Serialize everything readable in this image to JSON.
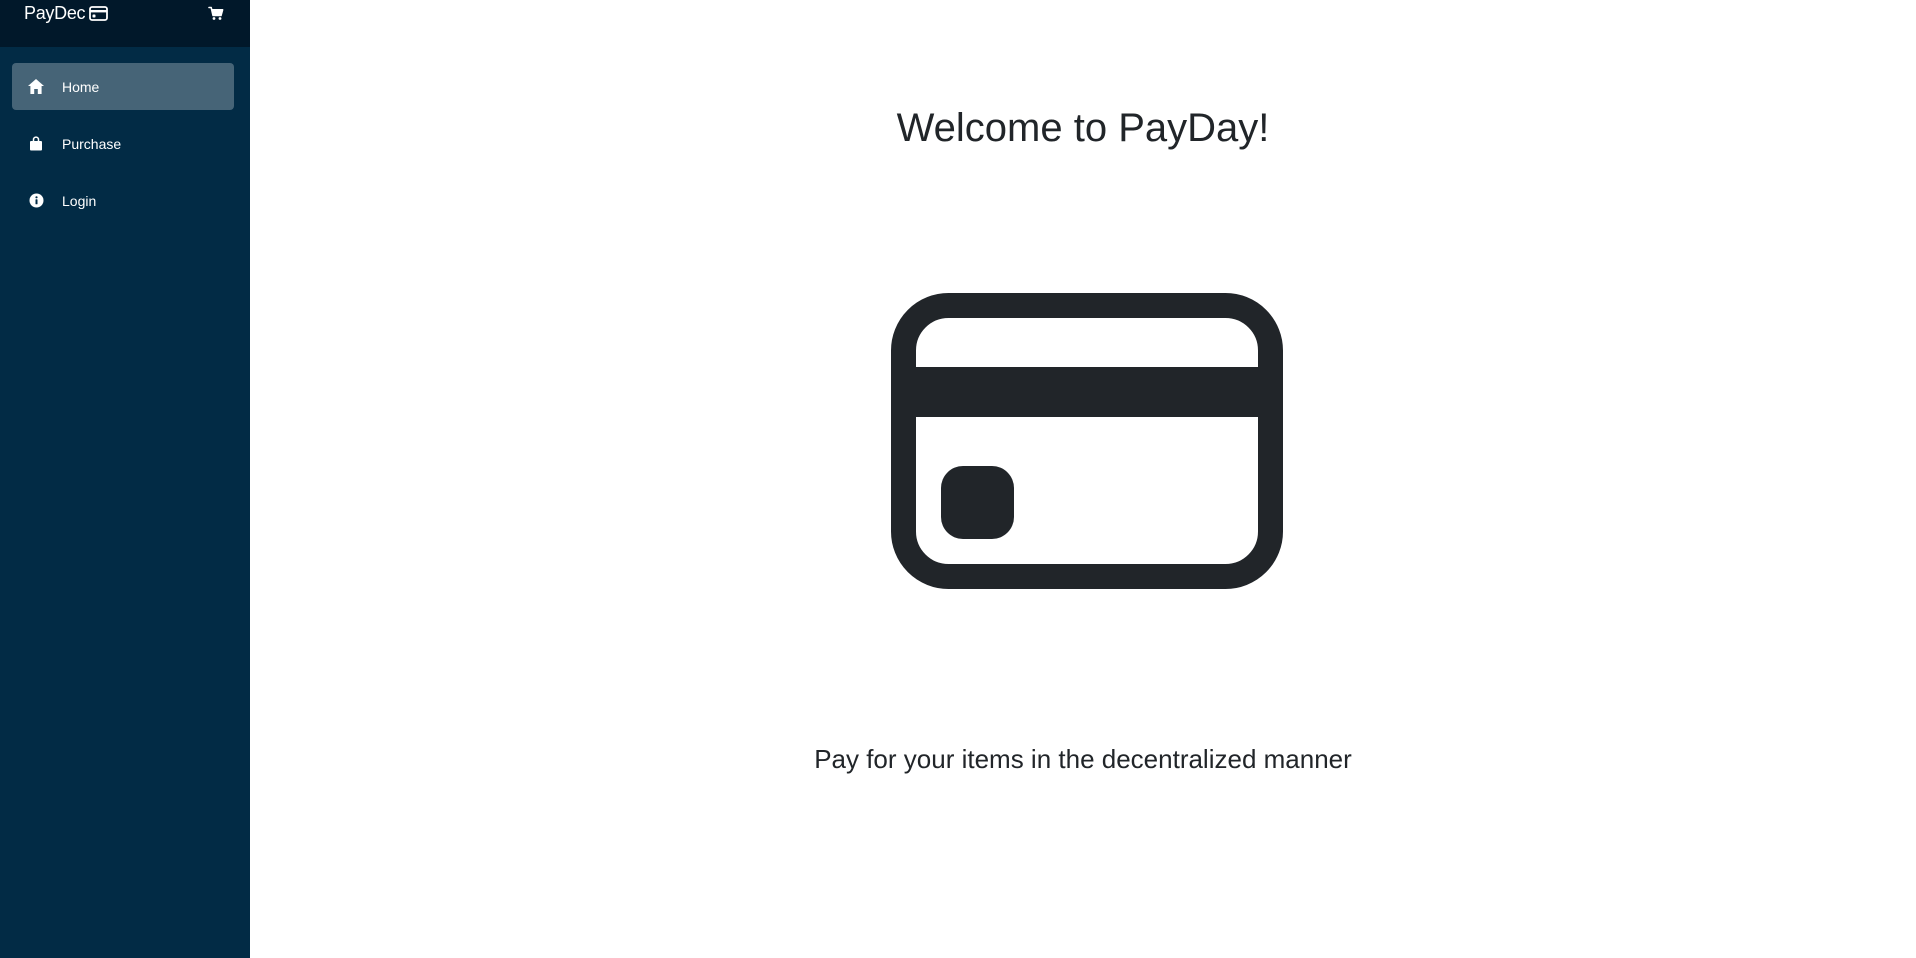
{
  "sidebar": {
    "brand": "PayDec",
    "brand_icon": "credit-card-icon",
    "cart_icon": "cart-icon",
    "items": [
      {
        "label": "Home",
        "icon": "home-icon",
        "active": true
      },
      {
        "label": "Purchase",
        "icon": "bag-icon",
        "active": false
      },
      {
        "label": "Login",
        "icon": "info-icon",
        "active": false
      }
    ]
  },
  "main": {
    "title": "Welcome to PayDay!",
    "hero_icon": "credit-card-icon",
    "tagline": "Pay for your items in the decentralized manner"
  },
  "colors": {
    "sidebar_bg": "#022b45",
    "sidebar_header_bg": "#01182a",
    "active_item_bg": "#4a6779",
    "text_dark": "#212529"
  }
}
